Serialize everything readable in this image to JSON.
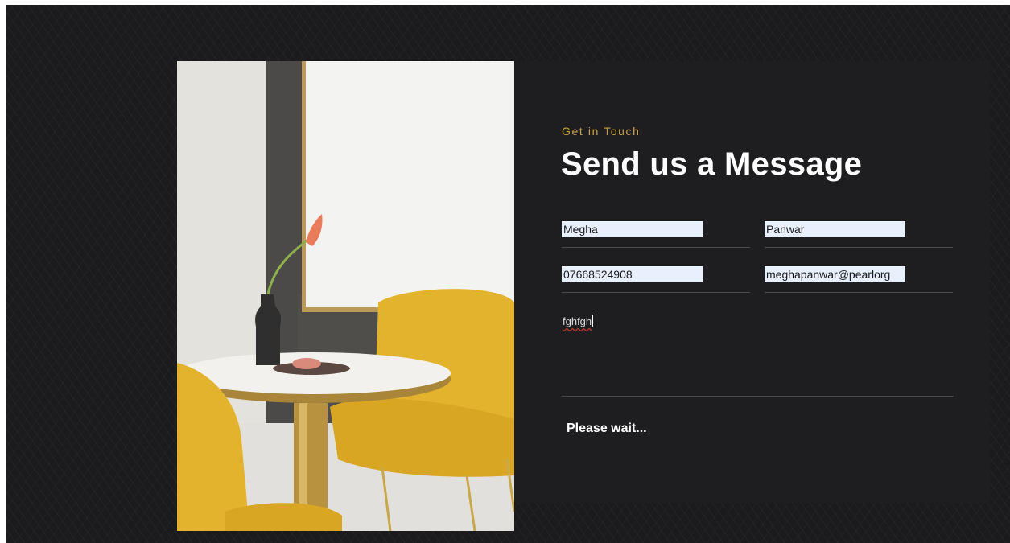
{
  "contact_form": {
    "eyebrow": "Get in Touch",
    "heading": "Send us a Message",
    "first_name_value": "Megha",
    "last_name_value": "Panwar",
    "phone_value": "07668524908",
    "email_value": "meghapanwar@pearlorg",
    "message_value": "fghfgh",
    "status_text": "Please wait..."
  },
  "colors": {
    "page_background": "#1b1b1d",
    "panel_background": "#1e1e21",
    "accent": "#c9a13f",
    "autofill": "#e8f0fe",
    "chair_yellow": "#e3b32e"
  }
}
